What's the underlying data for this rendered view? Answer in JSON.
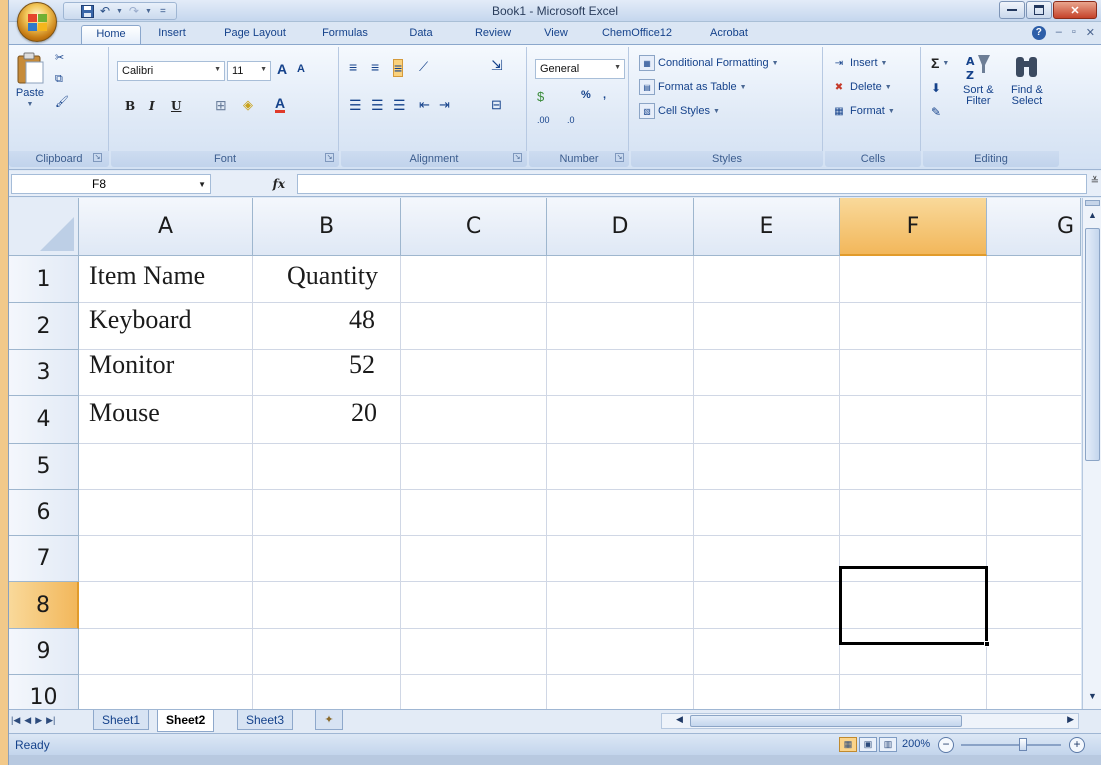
{
  "window": {
    "title": "Book1 - Microsoft Excel"
  },
  "ribbon_tabs": [
    "Home",
    "Insert",
    "Page Layout",
    "Formulas",
    "Data",
    "Review",
    "View",
    "ChemOffice12",
    "Acrobat"
  ],
  "active_tab": "Home",
  "ribbon": {
    "clipboard": {
      "label": "Clipboard",
      "paste": "Paste"
    },
    "font": {
      "label": "Font",
      "name": "Calibri",
      "size": "11",
      "bold": "B",
      "italic": "I",
      "underline": "U",
      "grow": "A",
      "shrink": "A",
      "font_color": "A"
    },
    "alignment": {
      "label": "Alignment"
    },
    "number": {
      "label": "Number",
      "format": "General",
      "percent": "%",
      "comma": ",",
      "inc_decimal": ".00",
      "dec_decimal": ".0"
    },
    "styles": {
      "label": "Styles",
      "conditional": "Conditional Formatting",
      "format_table": "Format as Table",
      "cell_styles": "Cell Styles"
    },
    "cells": {
      "label": "Cells",
      "insert": "Insert",
      "delete": "Delete",
      "format": "Format"
    },
    "editing": {
      "label": "Editing",
      "sum": "Σ",
      "sort_filter_1": "Sort &",
      "sort_filter_2": "Filter",
      "find_select_1": "Find &",
      "find_select_2": "Select"
    }
  },
  "formula_bar": {
    "name_box": "F8",
    "fx": "fx",
    "formula": ""
  },
  "sheet": {
    "columns": [
      "A",
      "B",
      "C",
      "D",
      "E",
      "F",
      "G"
    ],
    "rows": [
      "1",
      "2",
      "3",
      "4",
      "5",
      "6",
      "7",
      "8",
      "9",
      "10"
    ],
    "selected_column": "F",
    "selected_row": "8",
    "cells": {
      "A1": "Item Name",
      "B1": "Quantity",
      "A2": "Keyboard",
      "B2": "48",
      "A3": "Monitor",
      "B3": "52",
      "A4": "Mouse",
      "B4": "20"
    }
  },
  "sheet_tabs": [
    "Sheet1",
    "Sheet2",
    "Sheet3"
  ],
  "active_sheet": "Sheet2",
  "status": {
    "text": "Ready",
    "zoom": "200%"
  },
  "colors": {
    "accent_selected": "#f2b75b",
    "ribbon_text": "#15428b",
    "titlebar": "#c5d7ee"
  }
}
